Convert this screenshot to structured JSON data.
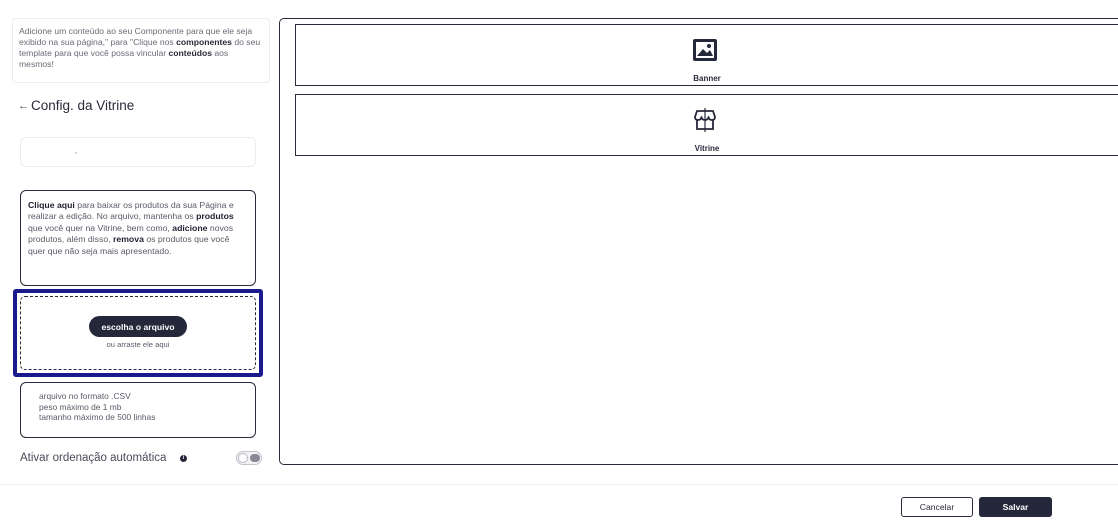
{
  "intro": {
    "line1": "Adicione um conteúdo ao seu Componente para que ele seja exibido na sua página,\" para \"Clique nos ",
    "bold1": "componentes",
    "line2": " do seu template para que você possa vincular ",
    "bold2": "conteúdos",
    "line3": " aos mesmos!"
  },
  "header": {
    "back_arrow": "←",
    "title": "Config. da Vitrine"
  },
  "name_input": {
    "value": "",
    "placeholder": ""
  },
  "info": {
    "b1": "Clique aqui",
    "t1": " para baixar os produtos da sua Página e realizar a edição. No arquivo, mantenha os ",
    "b2": "produtos",
    "t2": " que você quer na Vitrine, bem como, ",
    "b3": "adicione",
    "t3": " novos produtos, além disso, ",
    "b4": "remova",
    "t4": " os produtos que você quer que não seja mais apresentado."
  },
  "upload": {
    "button": "escolha o arquivo",
    "hint": "ou arraste ele aqui"
  },
  "rules": [
    "arquivo no formato .CSV",
    "peso máximo de 1 mb",
    "tamanho máximo de 500 linhas"
  ],
  "sort": {
    "label": "Ativar ordenação automática",
    "info_icon": "i",
    "enabled": false
  },
  "components": [
    {
      "label": "Banner",
      "icon": "image-icon"
    },
    {
      "label": "Vitrine",
      "icon": "storefront-icon"
    }
  ],
  "footer": {
    "cancel": "Cancelar",
    "save": "Salvar"
  },
  "colors": {
    "accent": "#25273a",
    "highlight": "#1a1a8c"
  }
}
